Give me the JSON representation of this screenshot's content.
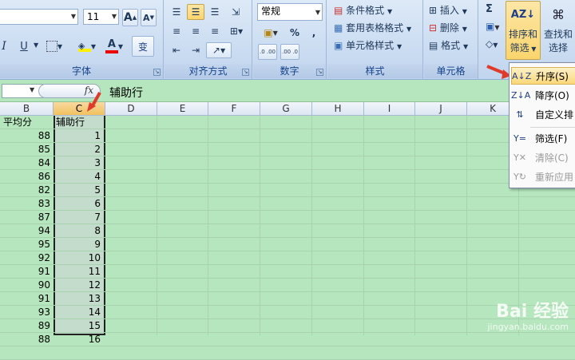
{
  "ribbon": {
    "font_group": {
      "label": "字体",
      "font_size": "11",
      "grow_label": "A",
      "shrink_label": "A",
      "italic": "I",
      "underline": "U",
      "font_color_label": "A",
      "wen": "变"
    },
    "align_group": {
      "label": "对齐方式"
    },
    "number_group": {
      "label": "数字",
      "format_value": "常规",
      "percent": "%",
      "comma": ",",
      "inc_decimal": ".0 .00",
      "dec_decimal": ".00 .0"
    },
    "style_group": {
      "label": "样式",
      "conditional": "条件格式",
      "table_format": "套用表格格式",
      "cell_style": "单元格样式"
    },
    "cells_group": {
      "label": "单元格",
      "insert": "插入",
      "delete": "删除",
      "format": "格式"
    },
    "edit_group": {
      "sum": "Σ",
      "sort_filter_l1": "排序和",
      "sort_filter_l2": "筛选",
      "find_l1": "查找和",
      "find_l2": "选择"
    }
  },
  "formula_bar": {
    "fx": "fx",
    "value": "辅助行"
  },
  "columns": [
    "B",
    "C",
    "D",
    "E",
    "F",
    "G",
    "H",
    "I",
    "J",
    "K"
  ],
  "sheet": {
    "header_b": "平均分",
    "header_c": "辅助行",
    "col_b": [
      "88",
      "85",
      "84",
      "86",
      "82",
      "83",
      "87",
      "94",
      "95",
      "92",
      "91",
      "90",
      "91",
      "93",
      "89",
      "88"
    ],
    "col_c": [
      "1",
      "2",
      "3",
      "4",
      "5",
      "6",
      "7",
      "8",
      "9",
      "10",
      "11",
      "12",
      "13",
      "14",
      "15",
      "16"
    ]
  },
  "menu": {
    "items": [
      {
        "label": "升序(S)",
        "icon": "A↓Z"
      },
      {
        "label": "降序(O)",
        "icon": "Z↓A"
      },
      {
        "label": "自定义排",
        "icon": "⇅"
      },
      {
        "label": "筛选(F)",
        "icon": "Y="
      },
      {
        "label": "清除(C)",
        "icon": "Y✕"
      },
      {
        "label": "重新应用",
        "icon": "Y↻"
      }
    ]
  },
  "watermark": {
    "brand": "Bai 经验",
    "url": "jingyan.baidu.com"
  },
  "colors": {
    "accent_arrow": "#e03a2a",
    "sheet_bg": "#b6e6bd",
    "ribbon_text": "#15428b"
  }
}
